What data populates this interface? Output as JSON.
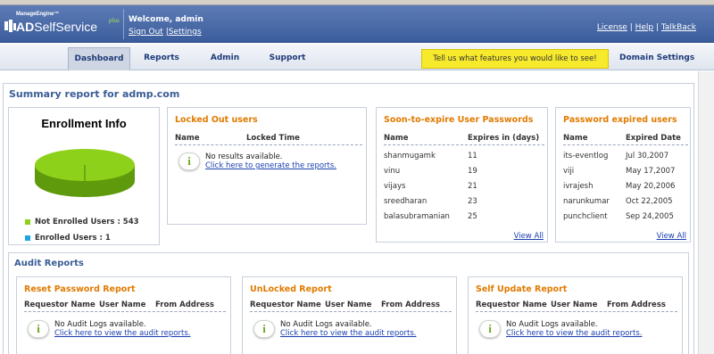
{
  "header": {
    "brand_small": "ManageEngine™",
    "brand_ad": "AD",
    "brand_rest": "SelfService",
    "brand_plus": "plus",
    "welcome": "Welcome, admin",
    "signout": "Sign Out",
    "settings": "|Settings",
    "links": [
      "License",
      "Help",
      "TalkBack"
    ]
  },
  "nav": {
    "tabs": [
      "Dashboard",
      "Reports",
      "Admin",
      "Support"
    ],
    "active": "Dashboard",
    "feature_banner": "Tell us what features you would like to see!",
    "domain_settings": "Domain Settings"
  },
  "summary": {
    "title": "Summary report for admp.com"
  },
  "enrollment": {
    "title": "Enrollment Info",
    "not_enrolled_label": "Not Enrolled Users : 543",
    "enrolled_label": "Enrolled Users : 1",
    "not_enrolled": 543,
    "enrolled": 1,
    "colors": {
      "not_enrolled": "#8ed11a",
      "enrolled": "#1ea5e0"
    }
  },
  "locked": {
    "title": "Locked Out users",
    "col1": "Name",
    "col2": "Locked Time",
    "msg": "No results available.",
    "link": "Click here to generate the reports."
  },
  "expire": {
    "title": "Soon-to-expire User Passwords",
    "col1": "Name",
    "col2": "Expires in (days)",
    "rows": [
      [
        "shanmugamk",
        "11"
      ],
      [
        "vinu",
        "19"
      ],
      [
        "vijays",
        "21"
      ],
      [
        "sreedharan",
        "23"
      ],
      [
        "balasubramanian",
        "25"
      ]
    ],
    "viewall": "View All"
  },
  "expired": {
    "title": "Password expired users",
    "col1": "Name",
    "col2": "Expired Date",
    "rows": [
      [
        "its-eventlog",
        "Jul 30,2007"
      ],
      [
        "viji",
        "May 17,2007"
      ],
      [
        "ivrajesh",
        "May 20,2006"
      ],
      [
        "narunkumar",
        "Oct 22,2005"
      ],
      [
        "punchclient",
        "Sep 24,2005"
      ]
    ],
    "viewall": "View All"
  },
  "audit": {
    "title": "Audit Reports",
    "panels": [
      {
        "title": "Reset Password Report",
        "cols": [
          "Requestor Name",
          "User Name",
          "From Address"
        ],
        "msg": "No Audit Logs available.",
        "link": "Click here to view the audit reports."
      },
      {
        "title": "UnLocked Report",
        "cols": [
          "Requestor Name",
          "User Name",
          "From Address"
        ],
        "msg": "No Audit Logs available.",
        "link": "Click here to view the audit reports."
      },
      {
        "title": "Self Update Report",
        "cols": [
          "Requestor Name",
          "User Name",
          "From Address"
        ],
        "msg": "No Audit Logs available.",
        "link": "Click here to view the audit reports."
      }
    ]
  }
}
